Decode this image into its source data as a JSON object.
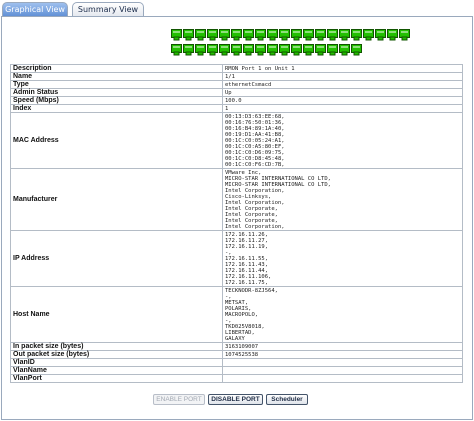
{
  "tabs": [
    {
      "label": "Graphical View",
      "active": true
    },
    {
      "label": "Summary View",
      "active": false
    }
  ],
  "ports": {
    "row1_count": 20,
    "row2_count": 16,
    "color": "#22c000",
    "outline": "#115500"
  },
  "details": [
    {
      "label": "Description",
      "lines": [
        "RMON Port 1 on Unit 1"
      ]
    },
    {
      "label": "Name",
      "lines": [
        "1/1"
      ]
    },
    {
      "label": "Type",
      "lines": [
        "ethernetCsmacd"
      ]
    },
    {
      "label": "Admin Status",
      "lines": [
        "Up"
      ]
    },
    {
      "label": "Speed (Mbps)",
      "lines": [
        "100.0"
      ]
    },
    {
      "label": "Index",
      "lines": [
        "1"
      ]
    },
    {
      "label": "MAC Address",
      "lines": [
        "00:13:D3:63:EE:68,",
        "00:16:76:50:01:36,",
        "00:16:B4:89:1A:40,",
        "00:19:D1:AA:41:B8,",
        "00:1C:C0:05:24:A1,",
        "00:1C:C0:A5:80:EF,",
        "00:1C:C0:D6:09:75,",
        "00:1C:C0:D8:45:48,",
        "00:1C:C0:F6:CD:7B,"
      ]
    },
    {
      "label": "Manufacturer",
      "lines": [
        "VMware Inc,",
        "MICRO-STAR INTERNATIONAL CO LTD,",
        "MICRO-STAR INTERNATIONAL CO LTD,",
        "Intel Corporation,",
        "Cisco-Linksys,",
        "Intel Corporation,",
        "Intel Corporate,",
        "Intel Corporate,",
        "Intel Corporate,",
        "Intel Corporation,"
      ]
    },
    {
      "label": "IP Address",
      "lines": [
        "172.16.11.26,",
        "172.16.11.27,",
        "172.16.11.19,",
        "-,",
        "172.16.11.55,",
        "172.16.11.43,",
        "172.16.11.44,",
        "172.16.11.106,",
        "172.16.11.75,"
      ]
    },
    {
      "label": "Host Name",
      "lines": [
        "TECKNODR-8ZJ564,",
        "-,",
        "METSAT,",
        "POLARIS,",
        "MACROPOLO,",
        "-,",
        "TKD025V8018,",
        "LIBERTAD,",
        "GALAXY"
      ]
    },
    {
      "label": "In packet size (bytes)",
      "lines": [
        "3163109007"
      ]
    },
    {
      "label": "Out packet size (bytes)",
      "lines": [
        "1074525538"
      ]
    },
    {
      "label": "VlanID",
      "lines": [
        ""
      ]
    },
    {
      "label": "VlanName",
      "lines": [
        ""
      ]
    },
    {
      "label": "VlanPort",
      "lines": [
        ""
      ]
    }
  ],
  "buttons": {
    "enable_label": "ENABLE PORT",
    "disable_label": "DISABLE PORT",
    "scheduler_label": "Scheduler"
  }
}
